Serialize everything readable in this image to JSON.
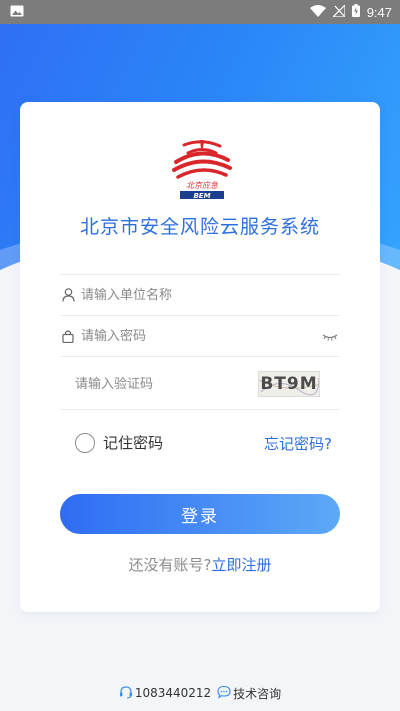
{
  "status_bar": {
    "time": "9:47"
  },
  "login": {
    "title": "北京市安全风险云服务系统",
    "logo_text": "北京应急",
    "logo_subtext": "BEM",
    "unit_placeholder": "请输入单位名称",
    "password_placeholder": "请输入密码",
    "captcha_placeholder": "请输入验证码",
    "captcha_text": "BT9M",
    "remember_label": "记住密码",
    "forgot_label": "忘记密码?",
    "login_button": "登录",
    "register_prompt": "还没有账号?",
    "register_link": "立即注册"
  },
  "footer": {
    "phone": "1083440212",
    "consult": "技术咨询"
  },
  "colors": {
    "primary": "#2d6fe0",
    "gradient_start": "#2f6cf3",
    "gradient_end": "#5da9f7",
    "logo_red": "#d8262b"
  }
}
